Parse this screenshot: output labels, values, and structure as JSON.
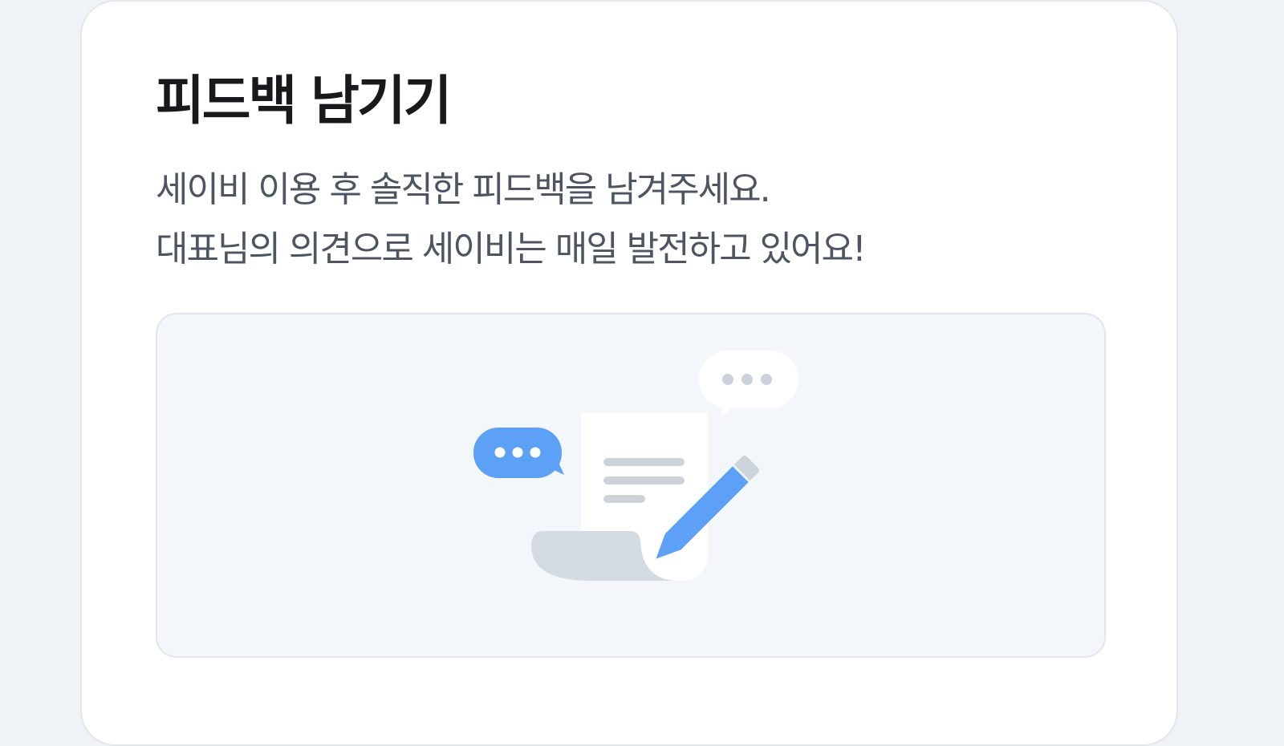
{
  "feedback": {
    "title": "피드백 남기기",
    "description_line1": "세이비 이용 후 솔직한 피드백을 남겨주세요.",
    "description_line2": "대표님의 의견으로 세이비는 매일 발전하고 있어요!"
  },
  "colors": {
    "page_background": "#eff2f6",
    "card_background": "#ffffff",
    "illustration_background": "#f3f6fa",
    "accent_blue": "#5ca1f5",
    "gray_light": "#d4dae2",
    "title_text": "#17191c",
    "body_text": "#4d5563"
  },
  "illustration": {
    "icons": [
      "document-icon",
      "pencil-icon",
      "chat-bubble-icon",
      "typing-bubble-icon"
    ]
  }
}
